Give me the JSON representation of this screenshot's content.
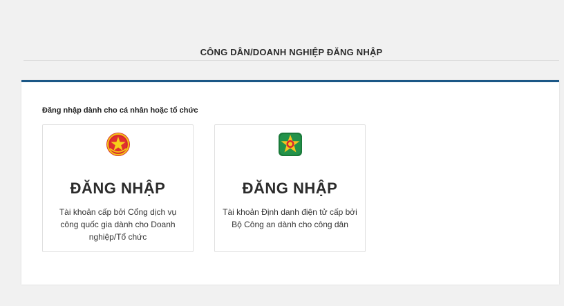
{
  "page": {
    "title": "CÔNG DÂN/DOANH NGHIỆP ĐĂNG NHẬP"
  },
  "login": {
    "subtitle": "Đăng nhập dành cho cá nhân hoặc tổ chức",
    "options": [
      {
        "heading": "ĐĂNG NHẬP",
        "description": "Tài khoản cấp bởi Cổng dịch vụ công quốc gia dành cho Doanh nghiệp/Tổ chức",
        "icon": "national-emblem-icon"
      },
      {
        "heading": "ĐĂNG NHẬP",
        "description": "Tài khoản Định danh điện tử cấp bởi Bộ Công an dành cho công dân",
        "icon": "police-emblem-icon"
      }
    ]
  },
  "colors": {
    "accent": "#1b5786",
    "background": "#f1f1f1",
    "card": "#ffffff"
  }
}
